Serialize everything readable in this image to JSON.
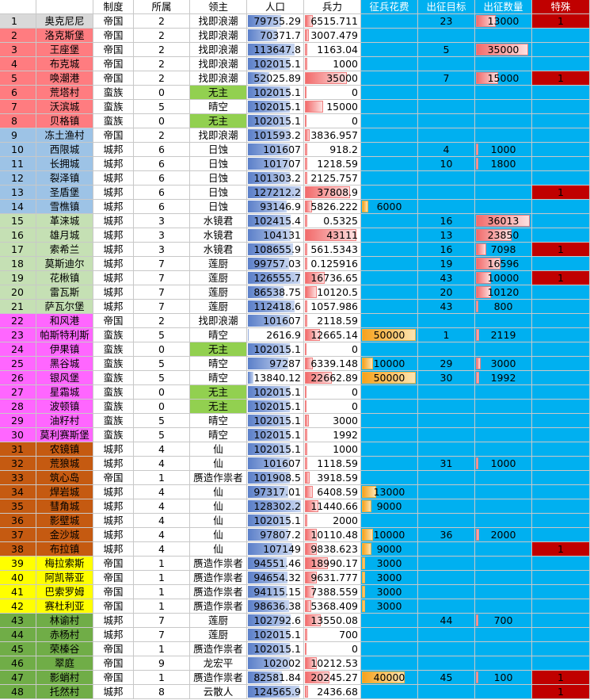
{
  "headers": [
    "",
    "制度",
    "所属",
    "领主",
    "人口",
    "兵力",
    "征兵花费",
    "出征目标",
    "出征数量",
    "特殊"
  ],
  "group_colors": {
    "g1": "#ff7c80",
    "g2": "#9dc3e6",
    "g3": "#c5e0b4",
    "g4": "#ff66ff",
    "g5": "#c55a11",
    "g6": "#ffff00",
    "g7": "#70ad47",
    "g0": "#d9d9d9"
  },
  "rows": [
    {
      "n": "1",
      "name": "奥克尼尼",
      "sys": "帝国",
      "own": "2",
      "lord": "找即浪潮",
      "pop": "79755.29",
      "force": "6515.711",
      "cost": "",
      "tgt": "23",
      "qty": "13000",
      "spec": "1",
      "g": "g0"
    },
    {
      "n": "2",
      "name": "洛克斯堡",
      "sys": "帝国",
      "own": "2",
      "lord": "找即浪潮",
      "pop": "70371.7",
      "force": "3007.479",
      "cost": "",
      "tgt": "",
      "qty": "",
      "spec": "",
      "g": "g1"
    },
    {
      "n": "3",
      "name": "王座堡",
      "sys": "帝国",
      "own": "2",
      "lord": "找即浪潮",
      "pop": "113647.8",
      "force": "1163.04",
      "cost": "",
      "tgt": "5",
      "qty": "35000",
      "spec": "",
      "g": "g1"
    },
    {
      "n": "4",
      "name": "布克城",
      "sys": "帝国",
      "own": "2",
      "lord": "找即浪潮",
      "pop": "102015.1",
      "force": "1000",
      "cost": "",
      "tgt": "",
      "qty": "",
      "spec": "",
      "g": "g1"
    },
    {
      "n": "5",
      "name": "唤潮港",
      "sys": "帝国",
      "own": "2",
      "lord": "找即浪潮",
      "pop": "52025.89",
      "force": "35000",
      "cost": "",
      "tgt": "7",
      "qty": "15000",
      "spec": "1",
      "g": "g1"
    },
    {
      "n": "6",
      "name": "荒塔村",
      "sys": "蛮族",
      "own": "0",
      "lord": "无主",
      "pop": "102015.1",
      "force": "0",
      "cost": "",
      "tgt": "",
      "qty": "",
      "spec": "",
      "g": "g1"
    },
    {
      "n": "7",
      "name": "沃滨城",
      "sys": "蛮族",
      "own": "5",
      "lord": "晴空",
      "pop": "102015.1",
      "force": "15000",
      "cost": "",
      "tgt": "",
      "qty": "",
      "spec": "",
      "g": "g1"
    },
    {
      "n": "8",
      "name": "贝格镇",
      "sys": "蛮族",
      "own": "0",
      "lord": "无主",
      "pop": "102015.1",
      "force": "0",
      "cost": "",
      "tgt": "",
      "qty": "",
      "spec": "",
      "g": "g1"
    },
    {
      "n": "9",
      "name": "冻土渔村",
      "sys": "帝国",
      "own": "2",
      "lord": "找即浪潮",
      "pop": "101593.2",
      "force": "3836.957",
      "cost": "",
      "tgt": "",
      "qty": "",
      "spec": "",
      "g": "g2"
    },
    {
      "n": "10",
      "name": "西限城",
      "sys": "城邦",
      "own": "6",
      "lord": "日蚀",
      "pop": "101607",
      "force": "918.2",
      "cost": "",
      "tgt": "4",
      "qty": "1000",
      "spec": "",
      "g": "g2"
    },
    {
      "n": "11",
      "name": "长拥城",
      "sys": "城邦",
      "own": "6",
      "lord": "日蚀",
      "pop": "101707",
      "force": "1218.59",
      "cost": "",
      "tgt": "10",
      "qty": "1800",
      "spec": "",
      "g": "g2"
    },
    {
      "n": "12",
      "name": "裂泽镇",
      "sys": "城邦",
      "own": "6",
      "lord": "日蚀",
      "pop": "101303.2",
      "force": "2125.757",
      "cost": "",
      "tgt": "",
      "qty": "",
      "spec": "",
      "g": "g2"
    },
    {
      "n": "13",
      "name": "圣盾堡",
      "sys": "城邦",
      "own": "6",
      "lord": "日蚀",
      "pop": "127212.2",
      "force": "37808.9",
      "cost": "",
      "tgt": "",
      "qty": "",
      "spec": "1",
      "g": "g2"
    },
    {
      "n": "14",
      "name": "雪樵镇",
      "sys": "城邦",
      "own": "6",
      "lord": "日蚀",
      "pop": "93146.9",
      "force": "5826.222",
      "cost": "6000",
      "tgt": "",
      "qty": "",
      "spec": "",
      "g": "g2"
    },
    {
      "n": "15",
      "name": "革涞城",
      "sys": "城邦",
      "own": "3",
      "lord": "水镜君",
      "pop": "102415.4",
      "force": "0.5325",
      "cost": "",
      "tgt": "16",
      "qty": "36013",
      "spec": "",
      "g": "g3"
    },
    {
      "n": "16",
      "name": "雄月城",
      "sys": "城邦",
      "own": "3",
      "lord": "水镜君",
      "pop": "104131",
      "force": "43111",
      "cost": "",
      "tgt": "13",
      "qty": "23850",
      "spec": "",
      "g": "g3"
    },
    {
      "n": "17",
      "name": "索希兰",
      "sys": "城邦",
      "own": "3",
      "lord": "水镜君",
      "pop": "108655.9",
      "force": "561.5343",
      "cost": "",
      "tgt": "16",
      "qty": "7098",
      "spec": "1",
      "g": "g3"
    },
    {
      "n": "18",
      "name": "莫斯迪尔",
      "sys": "城邦",
      "own": "7",
      "lord": "莲厨",
      "pop": "99757.03",
      "force": "0.125916",
      "cost": "",
      "tgt": "19",
      "qty": "16596",
      "spec": "",
      "g": "g3"
    },
    {
      "n": "19",
      "name": "花楸镇",
      "sys": "城邦",
      "own": "7",
      "lord": "莲厨",
      "pop": "126555.7",
      "force": "16736.65",
      "cost": "",
      "tgt": "43",
      "qty": "10000",
      "spec": "1",
      "g": "g3"
    },
    {
      "n": "20",
      "name": "雷瓦斯",
      "sys": "城邦",
      "own": "7",
      "lord": "莲厨",
      "pop": "86538.75",
      "force": "10120.5",
      "cost": "",
      "tgt": "20",
      "qty": "10120",
      "spec": "",
      "g": "g3"
    },
    {
      "n": "21",
      "name": "萨瓦尔堡",
      "sys": "城邦",
      "own": "7",
      "lord": "莲厨",
      "pop": "112418.6",
      "force": "1057.986",
      "cost": "",
      "tgt": "43",
      "qty": "800",
      "spec": "",
      "g": "g3"
    },
    {
      "n": "22",
      "name": "和风港",
      "sys": "帝国",
      "own": "2",
      "lord": "找即浪潮",
      "pop": "101607",
      "force": "2118.59",
      "cost": "",
      "tgt": "",
      "qty": "",
      "spec": "",
      "g": "g4"
    },
    {
      "n": "23",
      "name": "帕斯特利斯",
      "sys": "蛮族",
      "own": "5",
      "lord": "晴空",
      "pop": "2616.9",
      "force": "12665.14",
      "cost": "50000",
      "tgt": "1",
      "qty": "2119",
      "spec": "",
      "g": "g4"
    },
    {
      "n": "24",
      "name": "伊果镇",
      "sys": "蛮族",
      "own": "0",
      "lord": "无主",
      "pop": "102015.1",
      "force": "0",
      "cost": "",
      "tgt": "",
      "qty": "",
      "spec": "",
      "g": "g4"
    },
    {
      "n": "25",
      "name": "黑谷城",
      "sys": "蛮族",
      "own": "5",
      "lord": "晴空",
      "pop": "97287",
      "force": "6339.148",
      "cost": "10000",
      "tgt": "29",
      "qty": "3000",
      "spec": "",
      "g": "g4"
    },
    {
      "n": "26",
      "name": "银风堡",
      "sys": "蛮族",
      "own": "5",
      "lord": "晴空",
      "pop": "13840.12",
      "force": "22662.89",
      "cost": "50000",
      "tgt": "30",
      "qty": "1992",
      "spec": "",
      "g": "g4"
    },
    {
      "n": "27",
      "name": "星霜城",
      "sys": "蛮族",
      "own": "0",
      "lord": "无主",
      "pop": "102015.1",
      "force": "0",
      "cost": "",
      "tgt": "",
      "qty": "",
      "spec": "",
      "g": "g4"
    },
    {
      "n": "28",
      "name": "波顿镇",
      "sys": "蛮族",
      "own": "0",
      "lord": "无主",
      "pop": "102015.1",
      "force": "0",
      "cost": "",
      "tgt": "",
      "qty": "",
      "spec": "",
      "g": "g4"
    },
    {
      "n": "29",
      "name": "油籽村",
      "sys": "蛮族",
      "own": "5",
      "lord": "晴空",
      "pop": "102015.1",
      "force": "3000",
      "cost": "",
      "tgt": "",
      "qty": "",
      "spec": "",
      "g": "g4"
    },
    {
      "n": "30",
      "name": "莫利赛斯堡",
      "sys": "蛮族",
      "own": "5",
      "lord": "晴空",
      "pop": "102015.1",
      "force": "1992",
      "cost": "",
      "tgt": "",
      "qty": "",
      "spec": "",
      "g": "g4"
    },
    {
      "n": "31",
      "name": "农镜镇",
      "sys": "城邦",
      "own": "4",
      "lord": "仙",
      "pop": "102015.1",
      "force": "1000",
      "cost": "",
      "tgt": "",
      "qty": "",
      "spec": "",
      "g": "g5"
    },
    {
      "n": "32",
      "name": "荒狼城",
      "sys": "城邦",
      "own": "4",
      "lord": "仙",
      "pop": "101607",
      "force": "1118.59",
      "cost": "",
      "tgt": "31",
      "qty": "1000",
      "spec": "",
      "g": "g5"
    },
    {
      "n": "33",
      "name": "筑心岛",
      "sys": "帝国",
      "own": "1",
      "lord": "赝造作祟者",
      "pop": "101908.5",
      "force": "3918.59",
      "cost": "",
      "tgt": "",
      "qty": "",
      "spec": "",
      "g": "g5"
    },
    {
      "n": "34",
      "name": "焊岩城",
      "sys": "城邦",
      "own": "4",
      "lord": "仙",
      "pop": "97317.01",
      "force": "6408.59",
      "cost": "13000",
      "tgt": "",
      "qty": "",
      "spec": "",
      "g": "g5"
    },
    {
      "n": "35",
      "name": "彗角城",
      "sys": "城邦",
      "own": "4",
      "lord": "仙",
      "pop": "128302.2",
      "force": "11440.66",
      "cost": "9000",
      "tgt": "",
      "qty": "",
      "spec": "",
      "g": "g5"
    },
    {
      "n": "36",
      "name": "影壁城",
      "sys": "城邦",
      "own": "4",
      "lord": "仙",
      "pop": "102015.1",
      "force": "2000",
      "cost": "",
      "tgt": "",
      "qty": "",
      "spec": "",
      "g": "g5"
    },
    {
      "n": "37",
      "name": "金沙城",
      "sys": "城邦",
      "own": "4",
      "lord": "仙",
      "pop": "97807.2",
      "force": "10110.48",
      "cost": "10000",
      "tgt": "36",
      "qty": "2000",
      "spec": "",
      "g": "g5"
    },
    {
      "n": "38",
      "name": "布拉镇",
      "sys": "城邦",
      "own": "4",
      "lord": "仙",
      "pop": "107149",
      "force": "9838.623",
      "cost": "9000",
      "tgt": "",
      "qty": "",
      "spec": "1",
      "g": "g5"
    },
    {
      "n": "39",
      "name": "梅拉索斯",
      "sys": "帝国",
      "own": "1",
      "lord": "赝造作祟者",
      "pop": "94551.46",
      "force": "18990.17",
      "cost": "3000",
      "tgt": "",
      "qty": "",
      "spec": "",
      "g": "g6"
    },
    {
      "n": "40",
      "name": "阿凯蒂亚",
      "sys": "帝国",
      "own": "1",
      "lord": "赝造作祟者",
      "pop": "94654.32",
      "force": "9631.777",
      "cost": "3000",
      "tgt": "",
      "qty": "",
      "spec": "",
      "g": "g6"
    },
    {
      "n": "41",
      "name": "巴索罗姆",
      "sys": "帝国",
      "own": "1",
      "lord": "赝造作祟者",
      "pop": "94115.15",
      "force": "7388.559",
      "cost": "3000",
      "tgt": "",
      "qty": "",
      "spec": "",
      "g": "g6"
    },
    {
      "n": "42",
      "name": "赛杜利亚",
      "sys": "帝国",
      "own": "1",
      "lord": "赝造作祟者",
      "pop": "98636.38",
      "force": "5368.409",
      "cost": "3000",
      "tgt": "",
      "qty": "",
      "spec": "",
      "g": "g6"
    },
    {
      "n": "43",
      "name": "林谕村",
      "sys": "城邦",
      "own": "7",
      "lord": "莲厨",
      "pop": "102792.6",
      "force": "13550.08",
      "cost": "",
      "tgt": "44",
      "qty": "700",
      "spec": "",
      "g": "g7"
    },
    {
      "n": "44",
      "name": "赤杨村",
      "sys": "城邦",
      "own": "7",
      "lord": "莲厨",
      "pop": "102015.1",
      "force": "700",
      "cost": "",
      "tgt": "",
      "qty": "",
      "spec": "",
      "g": "g7"
    },
    {
      "n": "45",
      "name": "荣榛谷",
      "sys": "帝国",
      "own": "1",
      "lord": "赝造作祟者",
      "pop": "102015.1",
      "force": "0",
      "cost": "",
      "tgt": "",
      "qty": "",
      "spec": "",
      "g": "g7"
    },
    {
      "n": "46",
      "name": "翠庭",
      "sys": "帝国",
      "own": "9",
      "lord": "龙宏平",
      "pop": "102002",
      "force": "10212.53",
      "cost": "",
      "tgt": "",
      "qty": "",
      "spec": "",
      "g": "g7"
    },
    {
      "n": "47",
      "name": "影蛸村",
      "sys": "帝国",
      "own": "1",
      "lord": "赝造作祟者",
      "pop": "82581.84",
      "force": "20245.27",
      "cost": "40000",
      "tgt": "45",
      "qty": "100",
      "spec": "1",
      "g": "g7"
    },
    {
      "n": "48",
      "name": "托然村",
      "sys": "城邦",
      "own": "8",
      "lord": "云散人",
      "pop": "124565.9",
      "force": "2436.68",
      "cost": "",
      "tgt": "",
      "qty": "",
      "spec": "1",
      "g": "g7"
    }
  ]
}
